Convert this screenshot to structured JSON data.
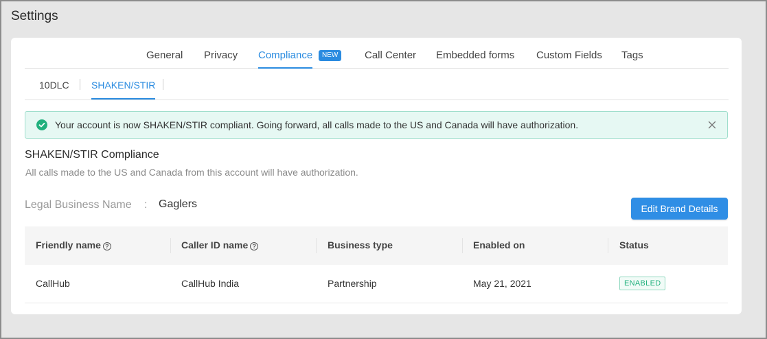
{
  "page": {
    "title": "Settings"
  },
  "main_tabs": [
    {
      "label": "General"
    },
    {
      "label": "Privacy"
    },
    {
      "label": "Compliance",
      "badge": "NEW",
      "active": true
    },
    {
      "label": "Call Center"
    },
    {
      "label": "Embedded forms"
    },
    {
      "label": "Custom Fields"
    },
    {
      "label": "Tags"
    }
  ],
  "sub_tabs": [
    {
      "label": "10DLC"
    },
    {
      "label": "SHAKEN/STIR",
      "active": true
    }
  ],
  "alert": {
    "icon": "check-circle-icon",
    "message": "Your account is now SHAKEN/STIR compliant. Going forward, all calls made to the US and Canada will have authorization.",
    "color": "#20b07d"
  },
  "section": {
    "title": "SHAKEN/STIR Compliance",
    "subtitle": "All calls made to the US and Canada from this account will have authorization."
  },
  "business": {
    "label": "Legal Business Name",
    "separator": ":",
    "value": "Gaglers",
    "edit_button": "Edit Brand Details"
  },
  "table": {
    "columns": [
      "Friendly name",
      "Caller ID name",
      "Business type",
      "Enabled on",
      "Status"
    ],
    "rows": [
      {
        "friendly_name": "CallHub",
        "caller_id_name": "CallHub India",
        "business_type": "Partnership",
        "enabled_on": "May 21, 2021",
        "status": "ENABLED"
      }
    ]
  },
  "colors": {
    "accent": "#2a8be0",
    "success": "#20b07d"
  }
}
